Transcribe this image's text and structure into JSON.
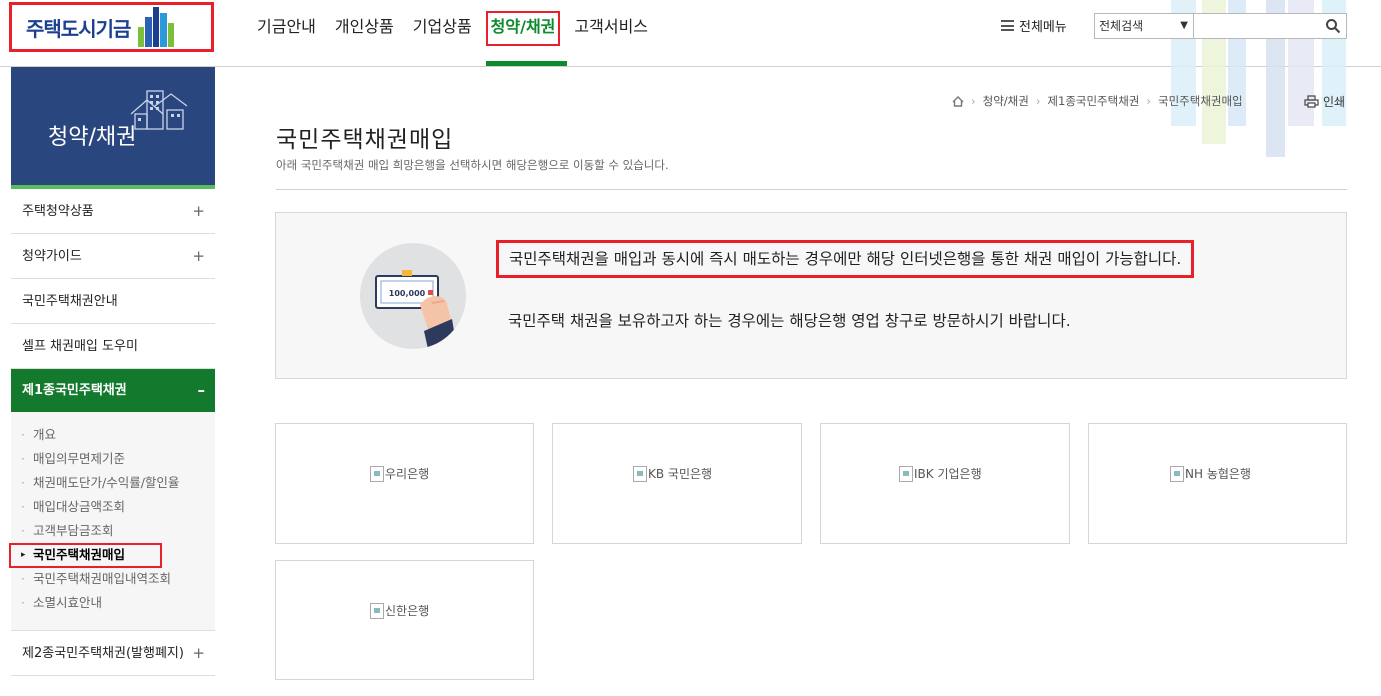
{
  "header": {
    "logo_text": "주택도시기금",
    "nav": [
      {
        "label": "기금안내"
      },
      {
        "label": "개인상품"
      },
      {
        "label": "기업상품"
      },
      {
        "label": "청약/채권",
        "active": true
      },
      {
        "label": "고객서비스"
      }
    ],
    "all_menu_label": "전체메뉴",
    "search_select_value": "전체검색",
    "search_input_value": ""
  },
  "sidebar": {
    "title": "청약/채권",
    "items": [
      {
        "label": "주택청약상품",
        "toggle": "+"
      },
      {
        "label": "청약가이드",
        "toggle": "+"
      },
      {
        "label": "국민주택채권안내",
        "toggle": ""
      },
      {
        "label": "셀프 채권매입 도우미",
        "toggle": ""
      },
      {
        "label": "제1종국민주택채권",
        "toggle": "–",
        "open": true
      },
      {
        "label": "제2종국민주택채권(발행폐지)",
        "toggle": "+"
      }
    ],
    "sub_items": [
      {
        "label": "개요"
      },
      {
        "label": "매입의무면제기준"
      },
      {
        "label": "채권매도단가/수익률/할인율"
      },
      {
        "label": "매입대상금액조회"
      },
      {
        "label": "고객부담금조회"
      },
      {
        "label": "국민주택채권매입",
        "active": true
      },
      {
        "label": "국민주택채권매입내역조회"
      },
      {
        "label": "소멸시효안내"
      }
    ]
  },
  "breadcrumb": [
    "청약/채권",
    "제1종국민주택채권",
    "국민주택채권매입"
  ],
  "print_label": "인쇄",
  "page": {
    "title": "국민주택채권매입",
    "description": "아래 국민주택채권 매입 희망은행을 선택하시면 해당은행으로 이동할 수 있습니다."
  },
  "notice": {
    "line1": "국민주택채권을 매입과 동시에 즉시 매도하는 경우에만 해당 인터넷은행을 통한 채권 매입이 가능합니다.",
    "line2": "국민주택 채권을 보유하고자 하는 경우에는 해당은행 영업 창구로 방문하시기 바랍니다.",
    "bill_amount": "100,000"
  },
  "banks": [
    {
      "label": "우리은행"
    },
    {
      "label": "KB 국민은행"
    },
    {
      "label": "IBK 기업은행"
    },
    {
      "label": "NH 농협은행"
    },
    {
      "label": "신한은행"
    }
  ],
  "colors": {
    "brand_green": "#0e8a2e",
    "sidebar_blue": "#2a467f",
    "highlight_red": "#e8202a",
    "logo_navy": "#1d3f8f"
  }
}
